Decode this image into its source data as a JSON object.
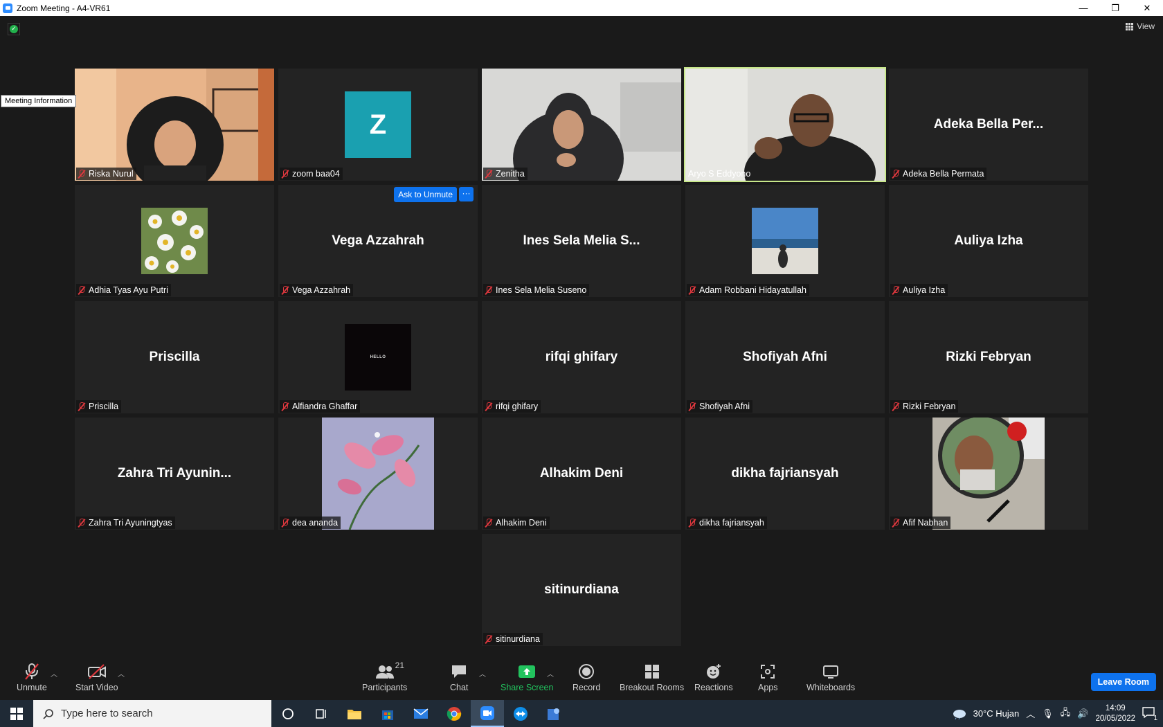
{
  "window": {
    "title": "Zoom Meeting - A4-VR61"
  },
  "meeting": {
    "view_label": "View",
    "meeting_info_tooltip": "Meeting Information"
  },
  "tiles": [
    {
      "big": "",
      "label": "Riska Nurul"
    },
    {
      "big": "",
      "label": "zoom baa04",
      "avatar_letter": "Z"
    },
    {
      "big": "",
      "label": "Zenitha"
    },
    {
      "big": "",
      "label": "Aryo S Eddyono"
    },
    {
      "big": "Adeka Bella Per...",
      "label": "Adeka Bella Permata"
    },
    {
      "big": "",
      "label": "Adhia Tyas Ayu Putri"
    },
    {
      "big": "Vega Azzahrah",
      "label": "Vega Azzahrah",
      "ask_unmute": "Ask to Unmute",
      "more": "···"
    },
    {
      "big": "Ines Sela Melia S...",
      "label": "Ines Sela Melia Suseno"
    },
    {
      "big": "",
      "label": "Adam Robbani Hidayatullah"
    },
    {
      "big": "Auliya Izha",
      "label": "Auliya Izha"
    },
    {
      "big": "Priscilla",
      "label": "Priscilla"
    },
    {
      "big": "",
      "label": "Alfiandra Ghaffar",
      "avatar_text": "HELLO"
    },
    {
      "big": "rifqi ghifary",
      "label": "rifqi ghifary"
    },
    {
      "big": "Shofiyah Afni",
      "label": "Shofiyah Afni"
    },
    {
      "big": "Rizki Febryan",
      "label": "Rizki Febryan"
    },
    {
      "big": "Zahra Tri Ayunin...",
      "label": "Zahra Tri Ayuningtyas"
    },
    {
      "big": "",
      "label": "dea ananda"
    },
    {
      "big": "Alhakim Deni",
      "label": "Alhakim Deni"
    },
    {
      "big": "dikha fajriansyah",
      "label": "dikha fajriansyah"
    },
    {
      "big": "",
      "label": "Afif Nabhan"
    },
    {
      "big": "sitinurdiana",
      "label": "sitinurdiana"
    }
  ],
  "toolbar": {
    "unmute": "Unmute",
    "start_video": "Start Video",
    "participants": "Participants",
    "participants_count": "21",
    "chat": "Chat",
    "share_screen": "Share Screen",
    "record": "Record",
    "breakout_rooms": "Breakout Rooms",
    "reactions": "Reactions",
    "apps": "Apps",
    "whiteboards": "Whiteboards",
    "leave_room": "Leave Room"
  },
  "taskbar": {
    "search_placeholder": "Type here to search",
    "weather": "30°C  Hujan",
    "time": "14:09",
    "date": "20/05/2022",
    "notification_count": "1"
  },
  "colors": {
    "accent_blue": "#0e72ed",
    "speaking_outline": "#c8e88a",
    "share_green": "#22c35e",
    "muted_red": "#e0383e",
    "avatar_teal": "#1aa0b0"
  }
}
